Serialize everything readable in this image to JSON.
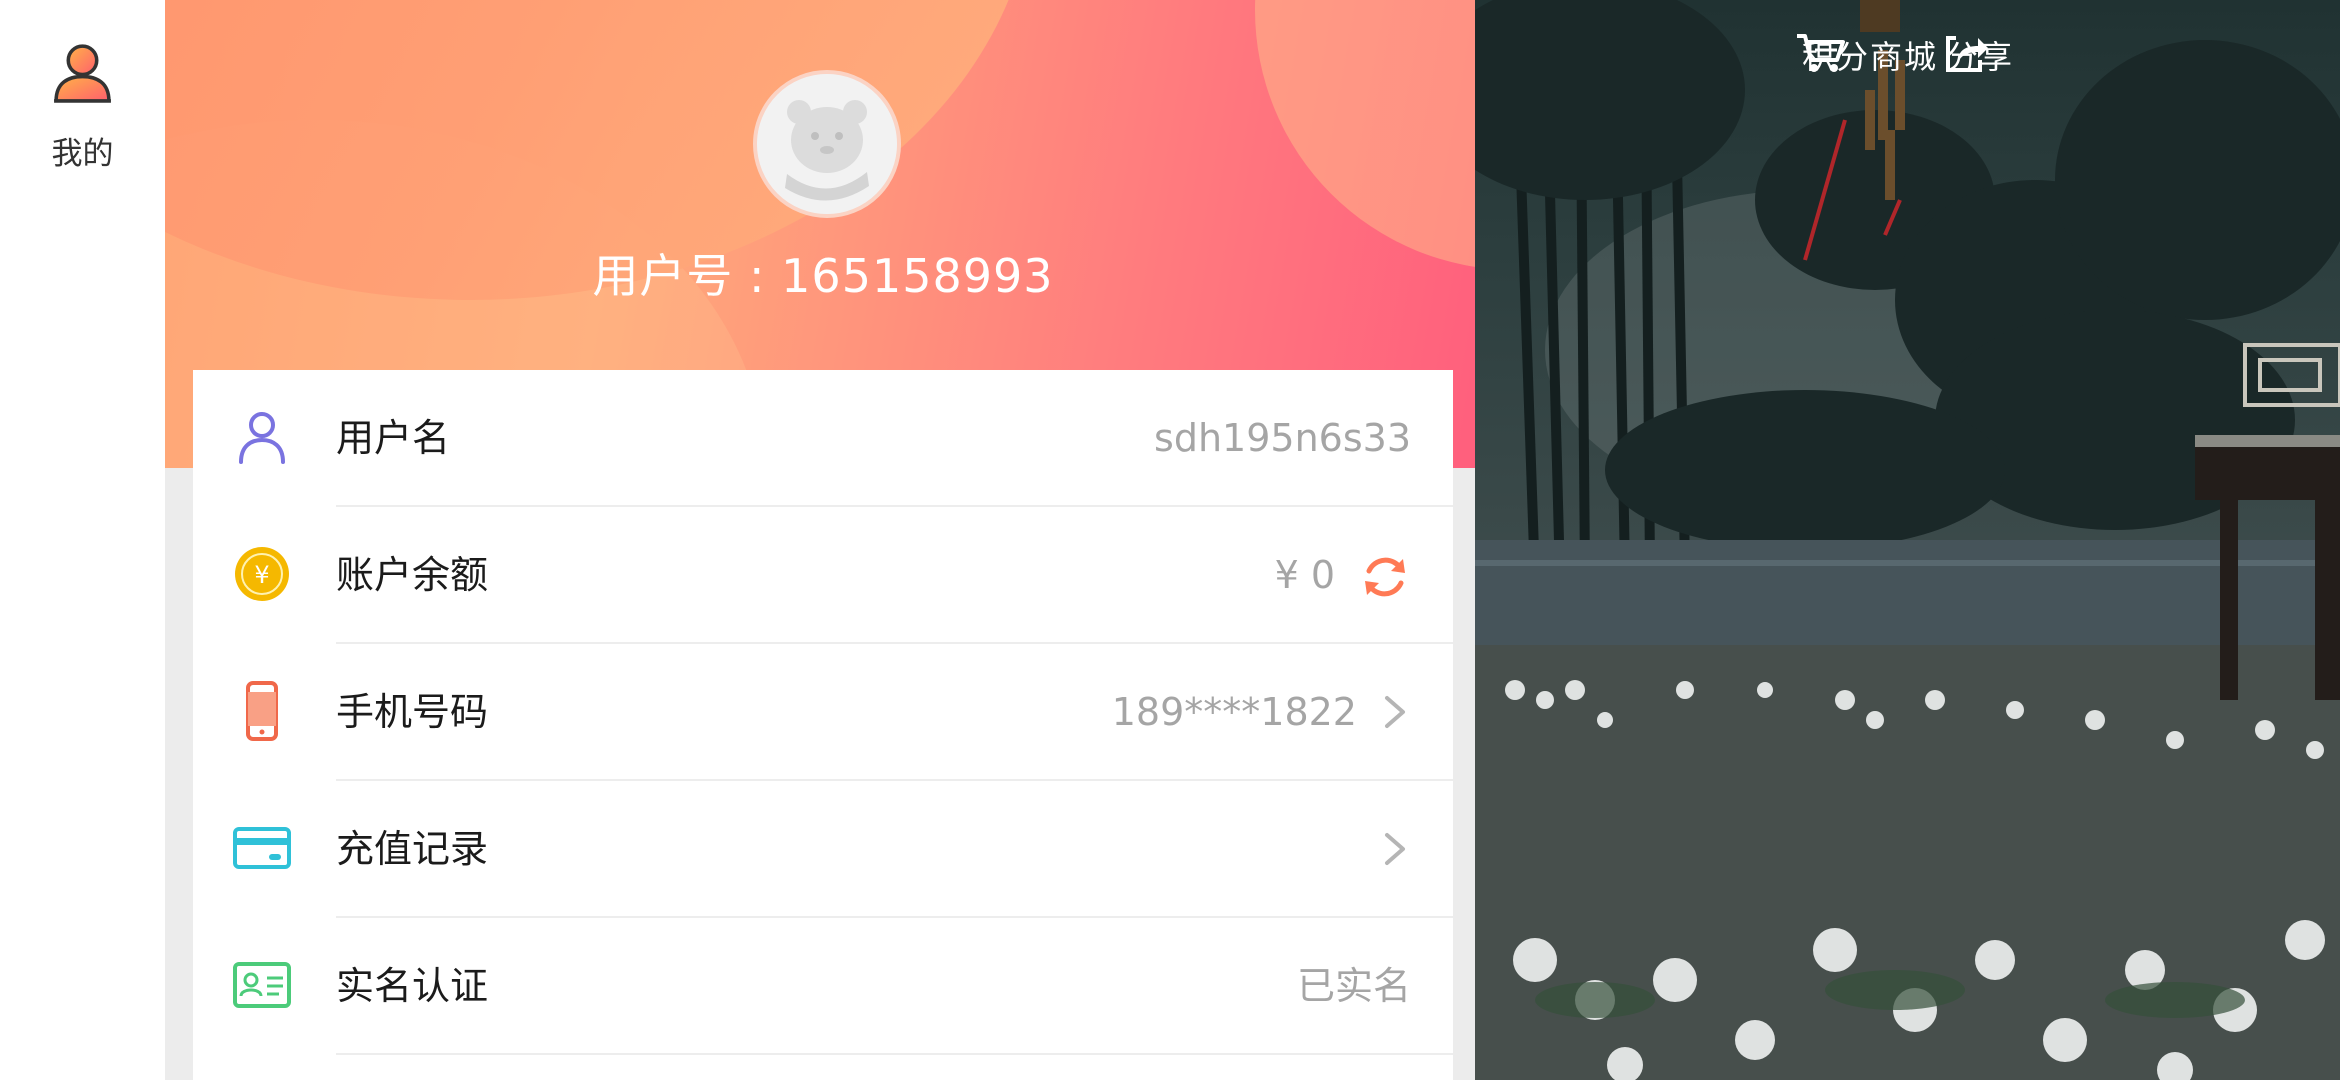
{
  "rail": {
    "tab_label": "我的",
    "icon": "user-profile-icon"
  },
  "profile": {
    "user_id_text": "用户号 : 165158993",
    "avatar_icon": "default-avatar"
  },
  "rows": [
    {
      "icon": "user-icon",
      "label": "用户名",
      "value": "sdh195n6s33"
    },
    {
      "icon": "coin-icon",
      "label": "账户余额",
      "value": "¥ 0",
      "action_icon": "refresh-icon"
    },
    {
      "icon": "phone-icon",
      "label": "手机号码",
      "value": "189****1822",
      "action_icon": "chevron-right-icon"
    },
    {
      "icon": "card-icon",
      "label": "充值记录",
      "value": "",
      "action_icon": "chevron-right-icon"
    },
    {
      "icon": "id-card-icon",
      "label": "实名认证",
      "value": "已实名"
    }
  ],
  "scene": {
    "mall_label": "积分商城",
    "share_label": "分享"
  },
  "colors": {
    "accent_orange": "#ff7a55",
    "hero_start": "#ffa070",
    "hero_end": "#ff5f7d",
    "user_icon": "#7a73e0",
    "coin": "#f5b800",
    "phone": "#f0684a",
    "card": "#2fc1d8",
    "id_card": "#4ccb7a"
  }
}
